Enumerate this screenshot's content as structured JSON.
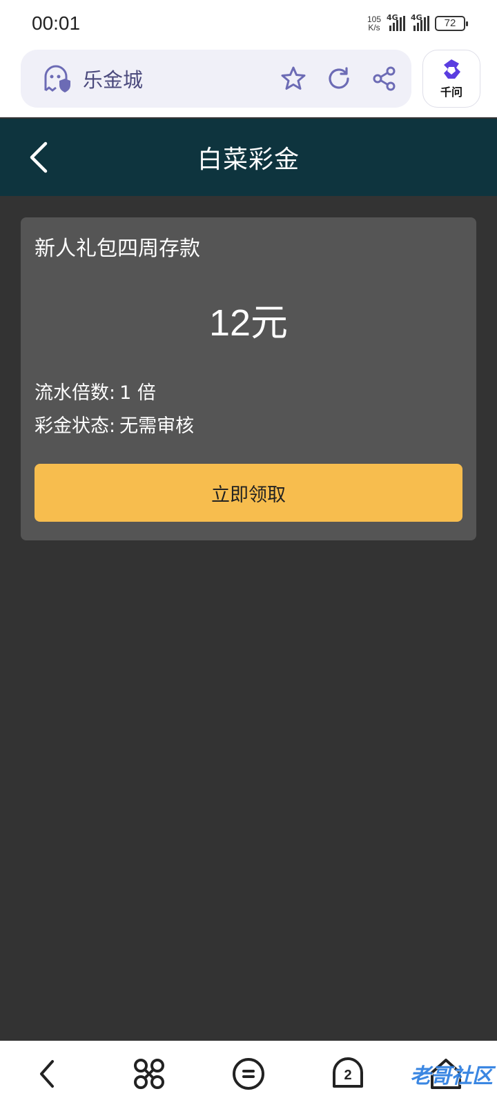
{
  "status_bar": {
    "time": "00:01",
    "net_speed_value": "105",
    "net_speed_unit": "K/s",
    "sim1_label": "4G",
    "sim2_label": "4G",
    "battery": "72"
  },
  "browser": {
    "site_title": "乐金城",
    "ai_label": "千问",
    "accent_color": "#6c6bb5"
  },
  "header": {
    "title": "白菜彩金",
    "background": "#0e343e"
  },
  "bonus_card": {
    "title": "新人礼包四周存款",
    "amount": "12元",
    "wager_label": "流水倍数:",
    "wager_value": "1 倍",
    "status_label": "彩金状态:",
    "status_value": "无需审核",
    "claim_label": "立即领取",
    "claim_color": "#f7bd4e"
  },
  "bottom_nav": {
    "tab_count": "2",
    "watermark": "老哥社区"
  }
}
